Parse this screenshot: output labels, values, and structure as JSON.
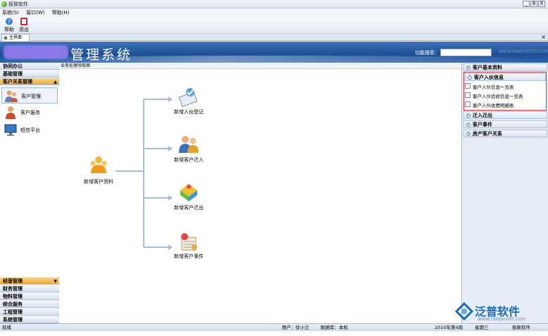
{
  "window": {
    "title": "极致软件",
    "controls": [
      "_",
      "8",
      "X"
    ]
  },
  "menu": {
    "items": [
      "系统(S)",
      "窗口(W)",
      "帮助(H)"
    ]
  },
  "toolbar": {
    "help_label": "帮助",
    "exit_label": "退出"
  },
  "tabs": {
    "main_label": "主界面",
    "close": "×"
  },
  "banner": {
    "title": "管理系统",
    "search_label": "功能搜索：",
    "watermark": "WWW.FANPUSOFT.COM"
  },
  "left_nav": {
    "sections_top": [
      "协同办公",
      "基础管理",
      "客户关系管理"
    ],
    "items": [
      "客户管理",
      "客户服务",
      "短信平台"
    ],
    "sections_bottom": [
      "经营管理",
      "财务管理",
      "物料管理",
      "综合服务",
      "工程管理",
      "系统管理"
    ]
  },
  "main": {
    "header": "业务处理导航图",
    "flow": {
      "source": "新增客户资料",
      "targets": [
        "新增入伙登记",
        "新增客户迁入",
        "新增客户迁出",
        "新增客户事件"
      ]
    }
  },
  "right_panel": {
    "sections": [
      "客户基本资料",
      "客户入伙信息",
      "迁入迁出",
      "客户事件",
      "房产客户关系"
    ],
    "subitems": [
      "客户入伙信息一览表",
      "客户入伙验收信息一览表",
      "客户入伙收费明细表"
    ]
  },
  "status": {
    "ready": "就绪",
    "user": "用户：徐小兰",
    "db": "数据库：本机",
    "week": "2010年第4周",
    "day": "星期三",
    "product": "极致软件"
  },
  "brand": {
    "name": "泛普软件",
    "url": "www.fanpusoft.com"
  }
}
